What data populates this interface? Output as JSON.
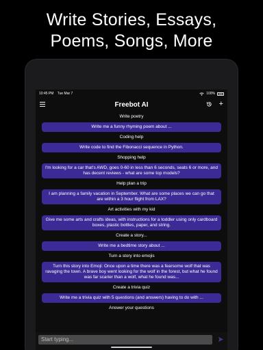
{
  "headline": {
    "line1": "Write Stories, Essays,",
    "line2": "Poems, Songs, More"
  },
  "status_bar": {
    "time": "10:45 PM",
    "date": "Tue Mar 7",
    "battery": "100%"
  },
  "app_bar": {
    "title": "Freebot AI",
    "icons": [
      "menu-icon",
      "history-icon",
      "plus-icon"
    ]
  },
  "sections": [
    {
      "title": "Write poetry",
      "prompt": "Write me a funny rhyming poem about ..."
    },
    {
      "title": "Coding help",
      "prompt": "Write code to find the Fibonacci sequence in Python."
    },
    {
      "title": "Shopping help",
      "prompt": "I'm looking for a car that's AWD, goes 0-60 in less than 6 seconds, seats 6 or more, and has decent reviews - what are some top models?"
    },
    {
      "title": "Help plan a trip",
      "prompt": "I am planning a family vacation in September. What are some places we can go that are within a 3 hour flight from LAX?"
    },
    {
      "title": "Art activities with my kid",
      "prompt": "Give me some arts and crafts ideas, with instructions for a toddler using only cardboard boxes, plastic bottles, paper, and string."
    },
    {
      "title": "Create a story...",
      "prompt": "Write me a bedtime story about ..."
    },
    {
      "title": "Turn a story into emojis",
      "prompt": "Turn this story into Emoji: Once upon a time there was a fearsome wolf that was ravaging the town. A brave boy went looking for the wolf in the forest, but what he found was far scarier than a wolf, what he found was..."
    },
    {
      "title": "Create a trivia quiz",
      "prompt": "Write me a trivia quiz with 5 questions (and answers) having to do with ..."
    },
    {
      "title": "Answer your questions",
      "prompt": ""
    }
  ],
  "input": {
    "placeholder": "Start typing..."
  },
  "colors": {
    "background": "#000000",
    "screen": "#0d0d0d",
    "prompt_bubble": "#3c2a96",
    "input_field": "#4a4a4c"
  }
}
